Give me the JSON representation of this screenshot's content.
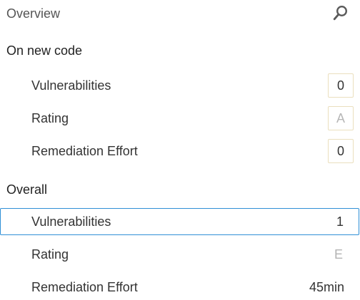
{
  "header": {
    "title": "Overview",
    "icon": "search-icon"
  },
  "sections": {
    "new_code": {
      "title": "On new code",
      "vulnerabilities_label": "Vulnerabilities",
      "vulnerabilities_value": "0",
      "rating_label": "Rating",
      "rating_value": "A",
      "remediation_label": "Remediation Effort",
      "remediation_value": "0"
    },
    "overall": {
      "title": "Overall",
      "vulnerabilities_label": "Vulnerabilities",
      "vulnerabilities_value": "1",
      "rating_label": "Rating",
      "rating_value": "E",
      "remediation_label": "Remediation Effort",
      "remediation_value": "45min"
    }
  },
  "colors": {
    "selected_border": "#2f8fd6",
    "value_box_border": "#eadfbe",
    "muted_rating": "#b7b7b7"
  }
}
